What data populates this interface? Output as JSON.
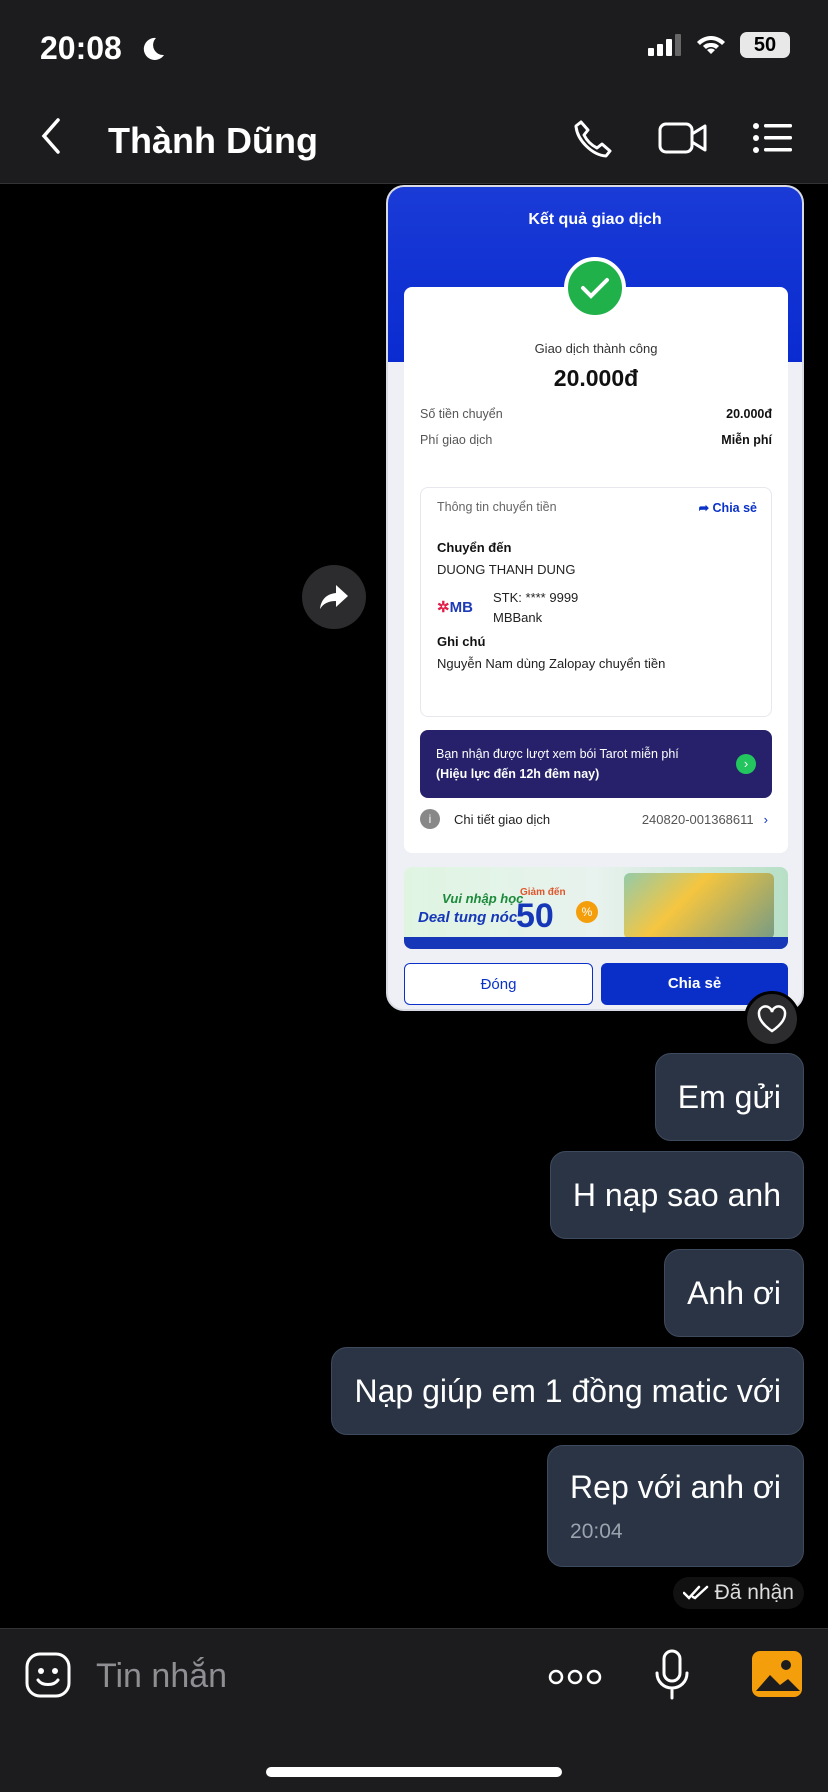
{
  "status": {
    "time": "20:08",
    "battery": "50"
  },
  "header": {
    "title": "Thành Dũng"
  },
  "receipt": {
    "title": "Kết quả giao dịch",
    "status_text": "Giao dịch thành công",
    "amount": "20.000đ",
    "rows": [
      {
        "label": "Số tiền chuyển",
        "value": "20.000đ"
      },
      {
        "label": "Phí giao dịch",
        "value": "Miễn phí"
      }
    ],
    "info_header": "Thông tin chuyển tiền",
    "share_link": "Chia sẻ",
    "to_label": "Chuyển đến",
    "to_name": "DUONG THANH DUNG",
    "bank_logo": "MB",
    "account": "STK: **** 9999",
    "bank_name": "MBBank",
    "note_label": "Ghi chú",
    "note": "Nguyễn Nam dùng Zalopay chuyển tiền",
    "banner_line1": "Bạn nhận được lượt xem bói Tarot miễn phí",
    "banner_line2": "(Hiệu lực đến 12h đêm nay)",
    "detail_label": "Chi tiết giao dịch",
    "transaction_id": "240820-001368611",
    "promo_small": "Vui nhập học",
    "promo_big": "Deal tung nóc",
    "promo_upto": "Giảm đến",
    "promo_pct": "50",
    "promo_pct_sign": "%",
    "btn_close": "Đóng",
    "btn_share": "Chia sẻ"
  },
  "messages": [
    {
      "text": "Em gửi"
    },
    {
      "text": "H nạp sao anh"
    },
    {
      "text": "Anh ơi"
    },
    {
      "text": "Nạp giúp em 1 đồng matic với"
    },
    {
      "text": "Rep với anh ơi",
      "time": "20:04"
    }
  ],
  "receipt_status": "Đã nhận",
  "input": {
    "placeholder": "Tin nhắn"
  }
}
